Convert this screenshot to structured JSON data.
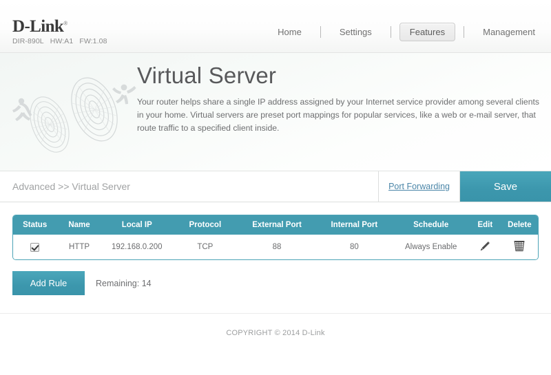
{
  "header": {
    "logo_text": "D-Link",
    "logo_reg": "®",
    "model": "DIR-890L",
    "hw": "HW:A1",
    "fw": "FW:1.08",
    "nav": [
      {
        "label": "Home",
        "active": false
      },
      {
        "label": "Settings",
        "active": false
      },
      {
        "label": "Features",
        "active": true
      },
      {
        "label": "Management",
        "active": false
      }
    ]
  },
  "hero": {
    "title": "Virtual Server",
    "description": "Your router helps share a single IP address assigned by your Internet service provider among several clients in your home. Virtual servers are preset port mappings for popular services, like a web or e-mail server, that route traffic to a specified client inside."
  },
  "actionbar": {
    "breadcrumb": "Advanced >> Virtual Server",
    "port_forwarding_label": "Port Forwarding",
    "save_label": "Save"
  },
  "table": {
    "columns": [
      "Status",
      "Name",
      "Local IP",
      "Protocol",
      "External Port",
      "Internal Port",
      "Schedule",
      "Edit",
      "Delete"
    ],
    "rows": [
      {
        "status_checked": true,
        "name": "HTTP",
        "local_ip": "192.168.0.200",
        "protocol": "TCP",
        "external_port": "88",
        "internal_port": "80",
        "schedule": "Always Enable",
        "edit_icon": "pencil-icon",
        "delete_icon": "trash-icon"
      }
    ]
  },
  "actions": {
    "add_rule_label": "Add Rule",
    "remaining_label": "Remaining: 14"
  },
  "footer": {
    "copyright": "COPYRIGHT © 2014 D-Link"
  },
  "colors": {
    "accent_teal": "#3c97ad",
    "table_header": "#439cb0",
    "link_blue": "#4b86a8",
    "title_gray": "#58595b"
  }
}
